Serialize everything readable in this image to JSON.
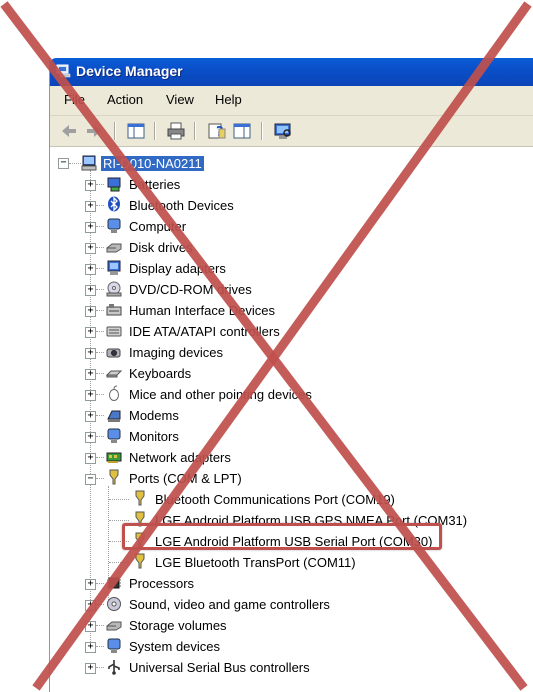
{
  "window": {
    "title": "Device Manager"
  },
  "menu": {
    "file": "File",
    "action": "Action",
    "view": "View",
    "help": "Help"
  },
  "toolbar": {
    "buttons": [
      "back-icon",
      "forward-icon",
      "console-tree-icon",
      "print-icon",
      "help-icon",
      "properties-icon",
      "scan-hardware-icon"
    ]
  },
  "tree": {
    "root": "RI-D010-NA0211",
    "items": [
      "Batteries",
      "Bluetooth Devices",
      "Computer",
      "Disk drives",
      "Display adapters",
      "DVD/CD-ROM drives",
      "Human Interface Devices",
      "IDE ATA/ATAPI controllers",
      "Imaging devices",
      "Keyboards",
      "Mice and other pointing devices",
      "Modems",
      "Monitors",
      "Network adapters",
      "Ports (COM & LPT)",
      "Processors",
      "Sound, video and game controllers",
      "Storage volumes",
      "System devices",
      "Universal Serial Bus controllers"
    ],
    "ports": [
      "Bluetooth Communications Port (COM19)",
      "LGE Android Platform USB GPS NMEA Port (COM31)",
      "LGE Android Platform USB Serial Port (COM30)",
      "LGE Bluetooth TransPort (COM11)"
    ]
  },
  "colors": {
    "cross": "#c0504d",
    "highlight": "#c0504d",
    "titlebar": "#0a5ed8",
    "selection": "#316ac5"
  }
}
